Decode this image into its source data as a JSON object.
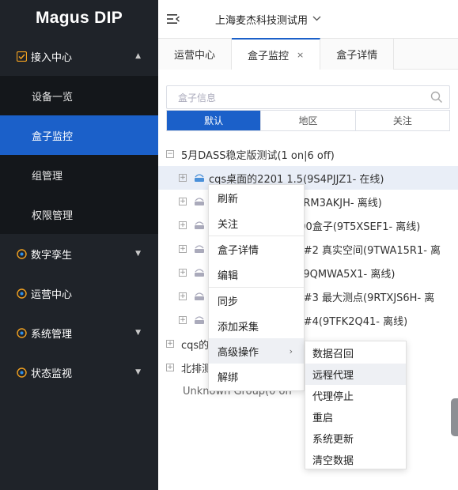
{
  "app": {
    "brand": "Magus DIP"
  },
  "sidebar": {
    "items": [
      {
        "label": "接入中心",
        "icon": "checkbox-icon",
        "expanded": true,
        "children": [
          {
            "label": "设备一览"
          },
          {
            "label": "盒子监控",
            "active": true
          },
          {
            "label": "组管理"
          },
          {
            "label": "权限管理"
          }
        ]
      },
      {
        "label": "数字孪生",
        "icon": "settings-icon"
      },
      {
        "label": "运营中心",
        "icon": "settings-icon"
      },
      {
        "label": "系统管理",
        "icon": "settings-icon"
      },
      {
        "label": "状态监视",
        "icon": "settings-icon"
      }
    ]
  },
  "header": {
    "organization": "上海麦杰科技测试用"
  },
  "tabs": [
    {
      "label": "运营中心"
    },
    {
      "label": "盒子监控",
      "active": true,
      "close": "×"
    },
    {
      "label": "盒子详情"
    }
  ],
  "search": {
    "placeholder": "盒子信息"
  },
  "segments": [
    {
      "label": "默认",
      "active": true
    },
    {
      "label": "地区"
    },
    {
      "label": "关注"
    }
  ],
  "tree": {
    "group1": "5月DASS稳定版测试(1 on|6 off)",
    "devices": [
      "cqs桌面的2201 1.5(9S4PJJZ1- 在线)",
      "(9RM3AKJH- 离线)",
      "200盒子(9T5XSEF1- 离线)",
      "iFi#2 真实空间(9TWA15R1- 离",
      "1(9QMWA5X1- 离线)",
      "iFi#3 最大测点(9RTXJS6H- 离",
      "iFi#4(9TFK2Q41- 离线)"
    ],
    "group2": "cqs的",
    "group3": "北排测",
    "group4": "Unknown Group(0 on"
  },
  "context_menu": {
    "items": [
      "刷新",
      "关注",
      "盒子详情",
      "编辑",
      "同步",
      "添加采集",
      "高级操作",
      "解绑"
    ],
    "advanced_arrow": "›"
  },
  "submenu": {
    "items": [
      "数据召回",
      "远程代理",
      "代理停止",
      "重启",
      "系统更新",
      "清空数据"
    ]
  }
}
